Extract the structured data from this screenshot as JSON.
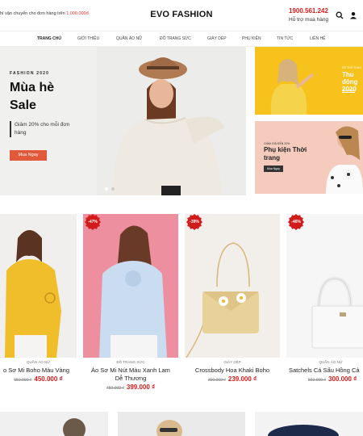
{
  "topbar": {
    "promo_text": "hí vận chuyển cho đơn hàng trên ",
    "promo_amount": "1.000.000đ",
    "logo": "EVO FASHION",
    "phone": "1900.561.242",
    "support": "Hỗ trợ mua hàng",
    "search_icon": "search-icon",
    "user_icon": "user-icon"
  },
  "nav": {
    "items": [
      "TRANG CHỦ",
      "GIỚI THIỆU",
      "QUẦN ÁO NỮ",
      "ĐỒ TRANG SỨC",
      "GIÀY DÉP",
      "PHỤ KIỆN",
      "TIN TỨC",
      "LIÊN HỆ"
    ]
  },
  "hero": {
    "kicker": "FASHION 2020",
    "title": "Mùa hè Sale",
    "subtitle": "Giảm 20% cho mỗi đơn hàng",
    "button": "Mua Ngay"
  },
  "banner1": {
    "small": "ĐỒ THỂ THAO",
    "big": "Thu đông 2020",
    "button": "Mua Ngay"
  },
  "banner2": {
    "small": "GIẢM GIÁ ĐẾN 20%",
    "big": "Phụ kiện Thời trang",
    "button": "Mua Ngay"
  },
  "products": [
    {
      "badge": "",
      "category": "QUẦN ÁO NỮ",
      "name": "o Sơ Mi Boho Màu Vàng",
      "old_price": "650.000 ₫",
      "price": "450.000 ₫"
    },
    {
      "badge": "-47%",
      "category": "ĐỒ TRANG SỨC",
      "name": "Áo Sơ Mi Nút Màu Xanh Lam",
      "name2": "Dễ Thương",
      "old_price": "750.000 ₫",
      "price": "399.000 ₫"
    },
    {
      "badge": "-39%",
      "category": "GIÀY DÉP",
      "name": "Crossbody Hoa Khaki Boho",
      "old_price": "390.000 ₫",
      "price": "239.000 ₫"
    },
    {
      "badge": "-46%",
      "category": "QUẦN ÁO NỮ",
      "name": "Satchels Cá Sấu Hồng Cả",
      "old_price": "560.000 ₫",
      "price": "300.000 ₫"
    }
  ],
  "colors": {
    "accent": "#d21b1b",
    "button": "#e2583b",
    "banner_yellow": "#f7c21b",
    "banner_pink": "#f4cbbc"
  }
}
